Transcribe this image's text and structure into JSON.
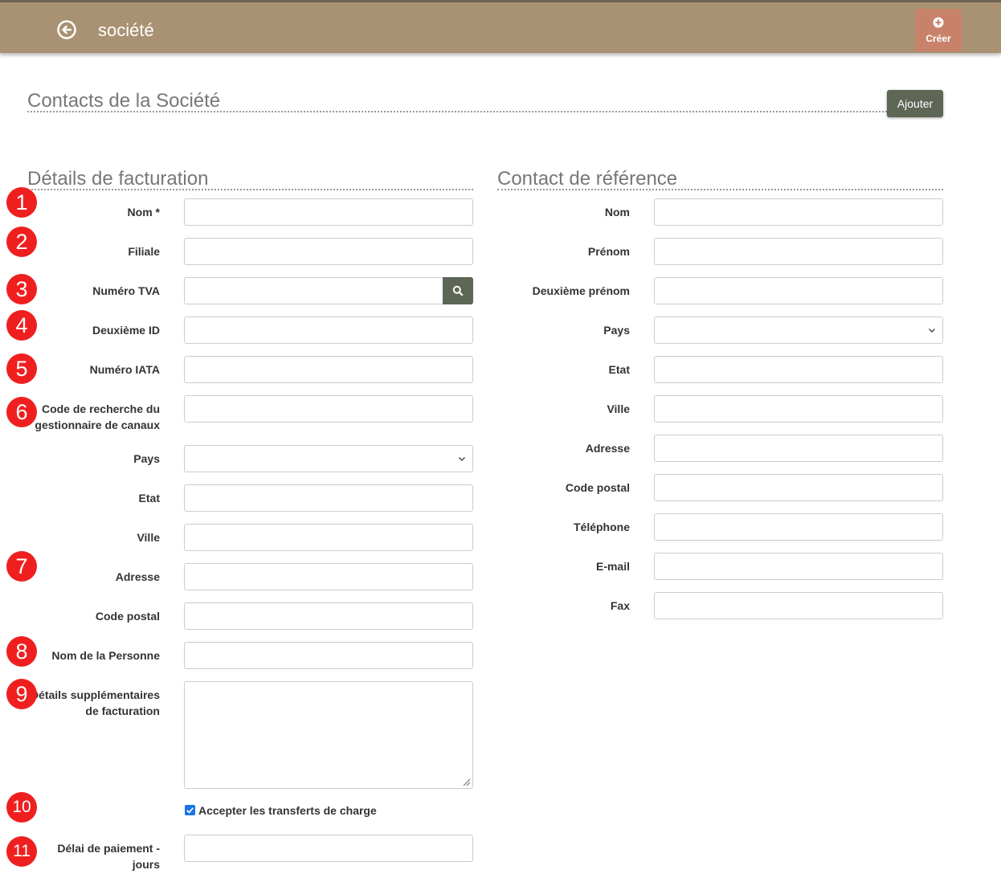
{
  "header": {
    "title": "société",
    "create_label": "Créer"
  },
  "contacts": {
    "title": "Contacts de la Société",
    "add_label": "Ajouter"
  },
  "billing": {
    "title": "Détails de facturation",
    "fields": {
      "nom": "Nom *",
      "filiale": "Filiale",
      "tva": "Numéro TVA",
      "second_id": "Deuxième ID",
      "iata": "Numéro IATA",
      "channel_code_1": "Code de recherche du",
      "channel_code_2": "gestionnaire de canaux",
      "pays": "Pays",
      "etat": "Etat",
      "ville": "Ville",
      "adresse": "Adresse",
      "code_postal": "Code postal",
      "personne": "Nom de la Personne",
      "details_1": "Détails supplémentaires",
      "details_2": "de facturation",
      "accept": "Accepter les transferts de charge",
      "delai_1": "Délai de paiement -",
      "delai_2": "jours"
    },
    "accept_checked": true
  },
  "reference": {
    "title": "Contact de référence",
    "fields": {
      "nom": "Nom",
      "prenom": "Prénom",
      "second_prenom": "Deuxième prénom",
      "pays": "Pays",
      "etat": "Etat",
      "ville": "Ville",
      "adresse": "Adresse",
      "code_postal": "Code postal",
      "telephone": "Téléphone",
      "email": "E-mail",
      "fax": "Fax"
    }
  },
  "markers": [
    "1",
    "2",
    "3",
    "4",
    "5",
    "6",
    "7",
    "8",
    "9",
    "10",
    "11"
  ],
  "colors": {
    "header_bg": "#a99273",
    "create_bg": "#c9826a",
    "button_bg": "#5e6655",
    "marker_bg": "#f01f1f",
    "checkbox": "#1a73e8"
  },
  "icons": {
    "back": "back-arrow-circle-icon",
    "create": "plus-circle-icon",
    "search": "search-icon",
    "select": "chevron-down-icon",
    "resize": "resize-handle-icon"
  }
}
